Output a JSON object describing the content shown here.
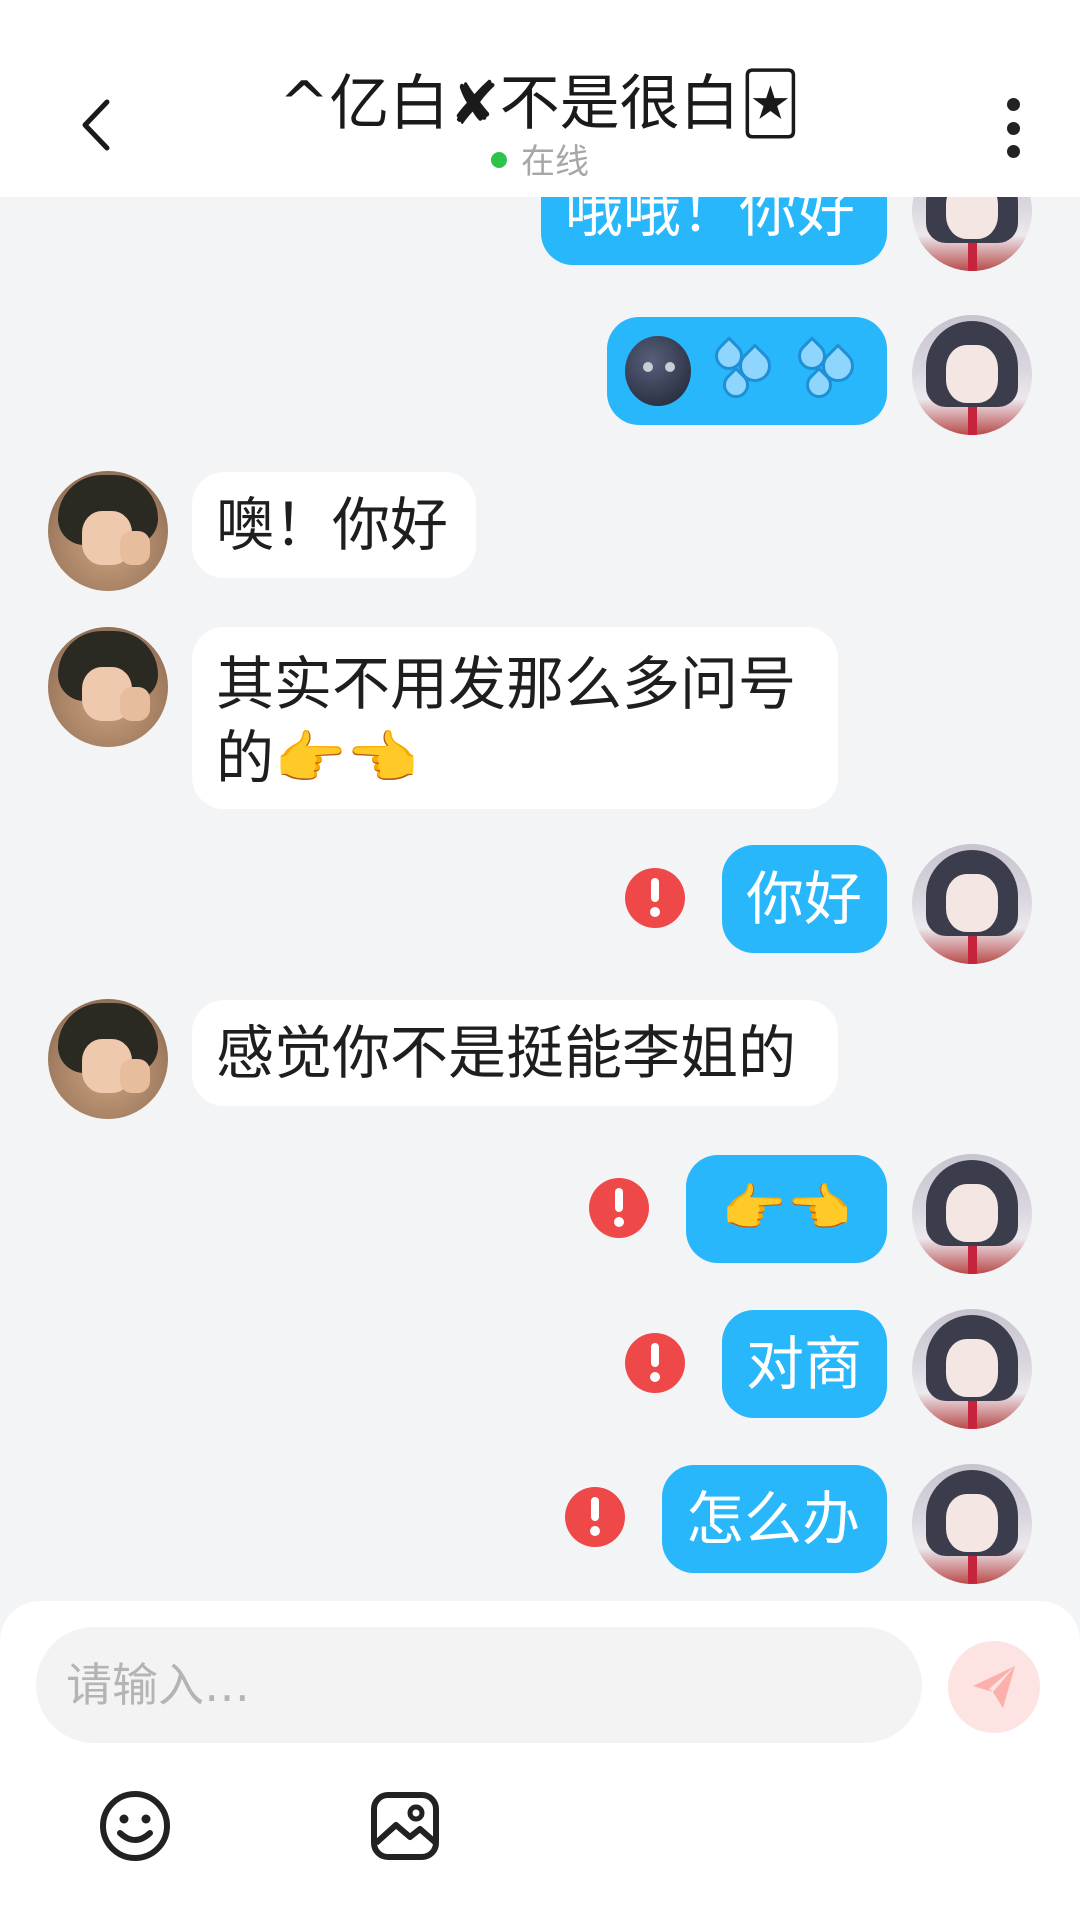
{
  "header": {
    "title": "^亿白✘不是很白🃏",
    "status": "在线",
    "back_icon": "chevron-left-icon",
    "more_icon": "more-vertical-icon"
  },
  "messages": [
    {
      "side": "me",
      "text": "哦哦！你好",
      "failed": false
    },
    {
      "side": "me",
      "text": "🌚💦💦",
      "failed": false
    },
    {
      "side": "other",
      "text": "噢！你好",
      "failed": false
    },
    {
      "side": "other",
      "text": "其实不用发那么多问号的👉👈",
      "failed": false
    },
    {
      "side": "me",
      "text": "你好",
      "failed": true
    },
    {
      "side": "other",
      "text": "感觉你不是挺能李姐的",
      "failed": false
    },
    {
      "side": "me",
      "text": "👉👈",
      "failed": true
    },
    {
      "side": "me",
      "text": "对商",
      "failed": true
    },
    {
      "side": "me",
      "text": "怎么办",
      "failed": true
    }
  ],
  "composer": {
    "placeholder": "请输入…",
    "send_icon": "send-icon",
    "tools": [
      "smiley-icon",
      "image-icon"
    ]
  },
  "colors": {
    "my_bubble": "#27b7fa",
    "other_bubble": "#ffffff",
    "error": "#ef4848",
    "online": "#2ec34a",
    "background": "#f3f4f6"
  }
}
